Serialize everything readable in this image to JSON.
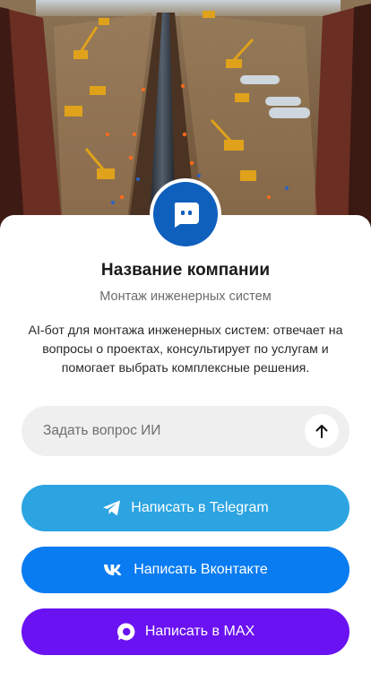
{
  "company": {
    "name": "Название компании",
    "subtitle": "Монтаж инженерных систем",
    "description": "AI-бот для монтажа инженерных систем: отвечает на вопросы о проектах, консультирует по услугам и помогает выбрать комплексные решения."
  },
  "ask": {
    "placeholder": "Задать вопрос ИИ",
    "send_icon": "arrow-up-icon"
  },
  "buttons": {
    "telegram": {
      "label": "Написать в Telegram",
      "icon": "telegram-icon"
    },
    "vk": {
      "label": "Написать Вконтакте",
      "icon": "vk-icon"
    },
    "max": {
      "label": "Написать в MAX",
      "icon": "max-chat-icon"
    }
  },
  "colors": {
    "logo_bg": "#0f5fbd",
    "telegram": "#2ca4e2",
    "vk": "#0a7cf2",
    "max": "#6a12f2",
    "input_bg": "#efefef"
  }
}
